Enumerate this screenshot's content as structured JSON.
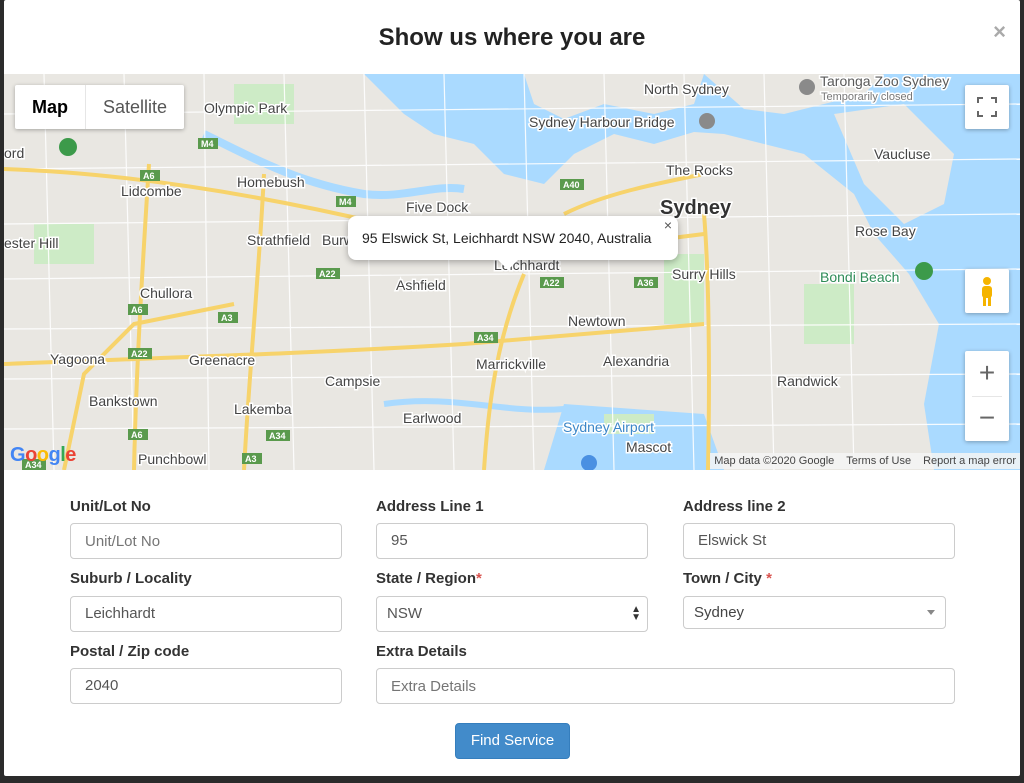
{
  "dialog": {
    "title": "Show us where you are",
    "close_label": "×"
  },
  "map": {
    "type_controls": {
      "map_label": "Map",
      "satellite_label": "Satellite",
      "selected": "Map"
    },
    "info_window": {
      "address": "95 Elswick St, Leichhardt NSW 2040, Australia",
      "close_label": "×"
    },
    "zoom": {
      "in_label": "+",
      "out_label": "−"
    },
    "logo": "Google",
    "attribution": {
      "map_data": "Map data ©2020 Google",
      "terms": "Terms of Use",
      "report": "Report a map error"
    },
    "place_labels": [
      "North Sydney",
      "Taronga Zoo Sydney",
      "Temporarily closed",
      "Sydney Harbour Bridge",
      "Sydney",
      "Olympic Park",
      "The Rocks",
      "Vaucluse",
      "Homebush",
      "Lidcombe",
      "Five Dock",
      "Strathfield",
      "Burw",
      "Leichhardt",
      "Rose Bay",
      "Surry Hills",
      "Bondi Beach",
      "Ashfield",
      "Chullora",
      "Newtown",
      "Yagoona",
      "Greenacre",
      "Marrickville",
      "Alexandria",
      "Campsie",
      "Randwick",
      "Bankstown",
      "Lakemba",
      "Earlwood",
      "Sydney Airport",
      "Mascot",
      "Punchbowl",
      "ord",
      "ester Hill"
    ],
    "road_shields": [
      "M4",
      "M4",
      "A6",
      "A40",
      "A22",
      "A22",
      "A36",
      "A3",
      "A6",
      "A22",
      "A34",
      "A6",
      "A34",
      "A3",
      "A34"
    ],
    "colors": {
      "water": "#aadaff",
      "land": "#e9e7e2",
      "park": "#cdebc6",
      "highway": "#f7d36b",
      "road": "#ffffff",
      "shield": "#5a9a4d"
    }
  },
  "form": {
    "unit": {
      "label": "Unit/Lot No",
      "placeholder": "Unit/Lot No",
      "value": ""
    },
    "address1": {
      "label": "Address Line 1",
      "value": "95"
    },
    "address2": {
      "label": "Address line 2",
      "value": "Elswick St"
    },
    "suburb": {
      "label": "Suburb / Locality",
      "value": "Leichhardt"
    },
    "state": {
      "label": "State / Region",
      "required_mark": "*",
      "value": "NSW"
    },
    "town": {
      "label": "Town / City",
      "required_mark": "*",
      "value": "Sydney"
    },
    "postal": {
      "label": "Postal / Zip code",
      "value": "2040"
    },
    "extra": {
      "label": "Extra Details",
      "placeholder": "Extra Details",
      "value": ""
    },
    "submit_label": "Find Service"
  }
}
